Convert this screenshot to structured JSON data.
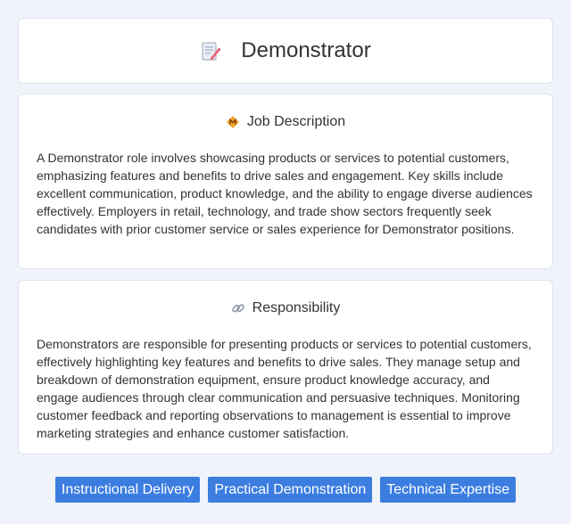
{
  "header": {
    "title": "Demonstrator",
    "icon": "document-edit-icon"
  },
  "job_description": {
    "heading": "Job Description",
    "icon": "diamond-badge-icon",
    "text": "A Demonstrator role involves showcasing products or services to potential customers, emphasizing features and benefits to drive sales and engagement. Key skills include excellent communication, product knowledge, and the ability to engage diverse audiences effectively. Employers in retail, technology, and trade show sectors frequently seek candidates with prior customer service or sales experience for Demonstrator positions."
  },
  "responsibility": {
    "heading": "Responsibility",
    "icon": "link-icon",
    "text": "Demonstrators are responsible for presenting products or services to potential customers, effectively highlighting key features and benefits to drive sales. They manage setup and breakdown of demonstration equipment, ensure product knowledge accuracy, and engage audiences through clear communication and persuasive techniques. Monitoring customer feedback and reporting observations to management is essential to improve marketing strategies and enhance customer satisfaction."
  },
  "tags": [
    "Instructional Delivery",
    "Practical Demonstration",
    "Technical Expertise"
  ],
  "colors": {
    "accent": "#3c7de0",
    "background": "#f0f3fa"
  }
}
